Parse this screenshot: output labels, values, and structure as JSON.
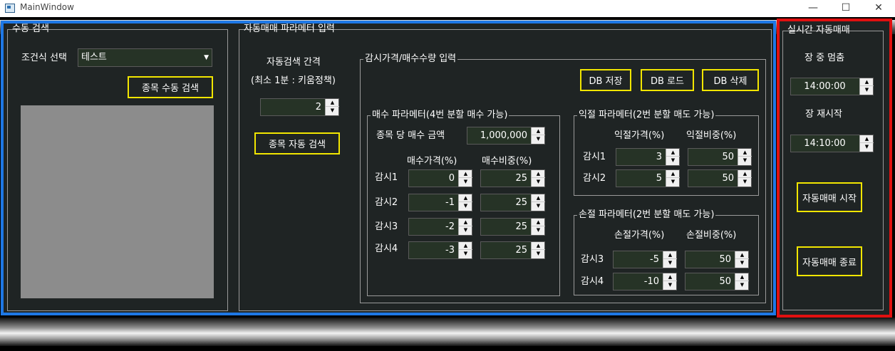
{
  "window": {
    "title": "MainWindow",
    "minimize_glyph": "—",
    "maximize_glyph": "☐",
    "close_glyph": "✕"
  },
  "manual": {
    "group_title": "수동 검색",
    "condition_label": "조건식 선택",
    "condition_value": "테스트",
    "search_button": "종목 수동 검색"
  },
  "auto_params": {
    "group_title": "자동매매 파라메터 입력",
    "interval_label": "자동검색 간격",
    "interval_note": "(최소 1분 : 키움정책)",
    "interval_value": "2",
    "auto_search_button": "종목 자동 검색"
  },
  "watch": {
    "group_title": "감시가격/매수수량 입력",
    "db_save": "DB 저장",
    "db_load": "DB 로드",
    "db_delete": "DB 삭제"
  },
  "buy": {
    "group_title": "매수 파라메터(4번 분할 매수 가능)",
    "amount_label": "종목 당 매수 금액",
    "amount_value": "1,000,000",
    "price_header": "매수가격(%)",
    "weight_header": "매수비중(%)",
    "rows": [
      {
        "label": "감시1",
        "price": "0",
        "weight": "25"
      },
      {
        "label": "감시2",
        "price": "-1",
        "weight": "25"
      },
      {
        "label": "감시3",
        "price": "-2",
        "weight": "25"
      },
      {
        "label": "감시4",
        "price": "-3",
        "weight": "25"
      }
    ]
  },
  "take_profit": {
    "group_title": "익절 파라메터(2번 분할 매도 가능)",
    "price_header": "익절가격(%)",
    "weight_header": "익절비중(%)",
    "rows": [
      {
        "label": "감시1",
        "price": "3",
        "weight": "50"
      },
      {
        "label": "감시2",
        "price": "5",
        "weight": "50"
      }
    ]
  },
  "stop_loss": {
    "group_title": "손절 파라메터(2번 분할 매도 가능)",
    "price_header": "손절가격(%)",
    "weight_header": "손절비중(%)",
    "rows": [
      {
        "label": "감시3",
        "price": "-5",
        "weight": "50"
      },
      {
        "label": "감시4",
        "price": "-10",
        "weight": "50"
      }
    ]
  },
  "realtime": {
    "group_title": "실시간 자동매매",
    "pause_label": "장 중 멈춤",
    "pause_time": "14:00:00",
    "restart_label": "장 재시작",
    "restart_time": "14:10:00",
    "start_button": "자동매매 시작",
    "stop_button": "자동매매 종료"
  },
  "colors": {
    "panel_bg": "#1f2424",
    "button_border": "#f2e600",
    "highlight_blue": "#1e78e6",
    "highlight_red": "#e01010",
    "spin_bg": "#263326"
  }
}
